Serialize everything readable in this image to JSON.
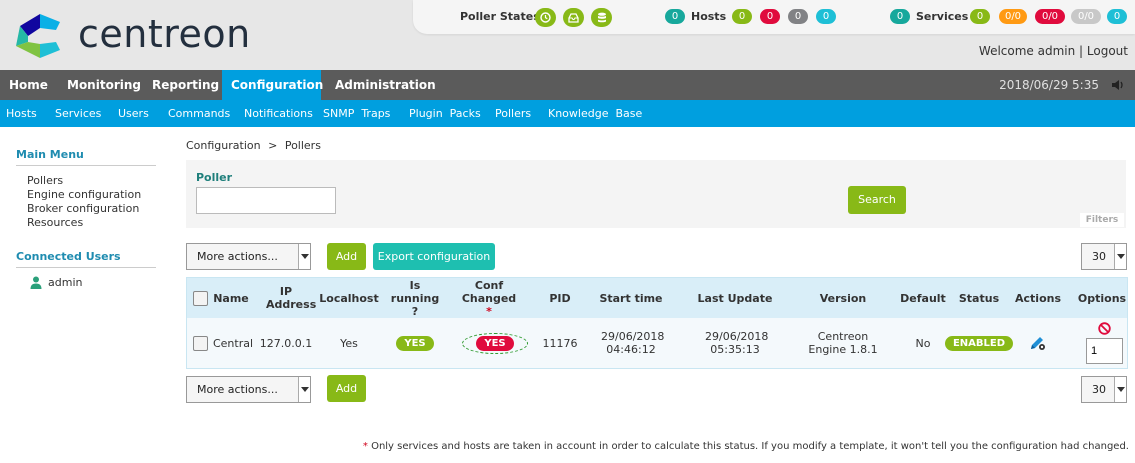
{
  "brand": {
    "name": "centreon"
  },
  "top": {
    "poller_states_label": "Poller States",
    "hosts_label": "Hosts",
    "hosts": {
      "total": "0",
      "up": "0",
      "down": "0",
      "unreachable": "0",
      "pending": "0"
    },
    "services_label": "Services",
    "services": {
      "total": "0",
      "ok": "0",
      "warning": "0/0",
      "critical": "0/0",
      "unknown": "0/0",
      "pending": "0"
    },
    "welcome": "Welcome admin",
    "separator": " | ",
    "logout": "Logout",
    "colors": {
      "green": "#88b917",
      "red": "#e00b3d",
      "grey": "#818285",
      "cyan": "#1ebfd6",
      "teal": "#17a89c",
      "orange": "#ff9a13",
      "lightgrey": "#c8c8c8"
    }
  },
  "nav": {
    "items": [
      {
        "label": "Home"
      },
      {
        "label": "Monitoring"
      },
      {
        "label": "Reporting"
      },
      {
        "label": "Configuration"
      },
      {
        "label": "Administration"
      }
    ],
    "datetime": "2018/06/29 5:35"
  },
  "subnav": {
    "items": [
      {
        "label": "Hosts"
      },
      {
        "label": "Services"
      },
      {
        "label": "Users"
      },
      {
        "label": "Commands"
      },
      {
        "label": "Notifications"
      },
      {
        "label": "SNMP  Traps"
      },
      {
        "label": "Plugin  Packs"
      },
      {
        "label": "Pollers"
      },
      {
        "label": "Knowledge  Base"
      }
    ]
  },
  "sidebar": {
    "main_menu": "Main Menu",
    "items": [
      {
        "label": "Pollers"
      },
      {
        "label": "Engine configuration"
      },
      {
        "label": "Broker configuration"
      },
      {
        "label": "Resources"
      }
    ],
    "connected_users": "Connected Users",
    "users": [
      {
        "label": "admin"
      }
    ]
  },
  "breadcrumb": {
    "a": "Configuration",
    "sep": ">",
    "b": "Pollers"
  },
  "filter": {
    "poller_label": "Poller",
    "poller_value": "",
    "search": "Search",
    "filters_label": "Filters"
  },
  "toolbar": {
    "more_actions": "More actions...",
    "add": "Add",
    "export": "Export configuration",
    "per_page": "30"
  },
  "table": {
    "headers": {
      "name": "Name",
      "ip": "IP Address",
      "localhost": "Localhost",
      "running": "Is running ?",
      "conf": "Conf Changed",
      "conf_star": "*",
      "pid": "PID",
      "start": "Start time",
      "update": "Last Update",
      "version": "Version",
      "default": "Default",
      "status": "Status",
      "actions": "Actions",
      "options": "Options"
    },
    "rows": [
      {
        "name": "Central",
        "ip": "127.0.0.1",
        "localhost": "Yes",
        "running": "YES",
        "conf": "YES",
        "pid": "11176",
        "start": "29/06/2018 04:46:12",
        "update": "29/06/2018 05:35:13",
        "version": "Centreon Engine 1.8.1",
        "default": "No",
        "status": "ENABLED",
        "option_value": "1"
      }
    ]
  },
  "footnote": {
    "star": "*",
    "text": " Only services and hosts are taken in account in order to calculate this status. If you modify a template, it won't tell you the configuration had changed."
  }
}
